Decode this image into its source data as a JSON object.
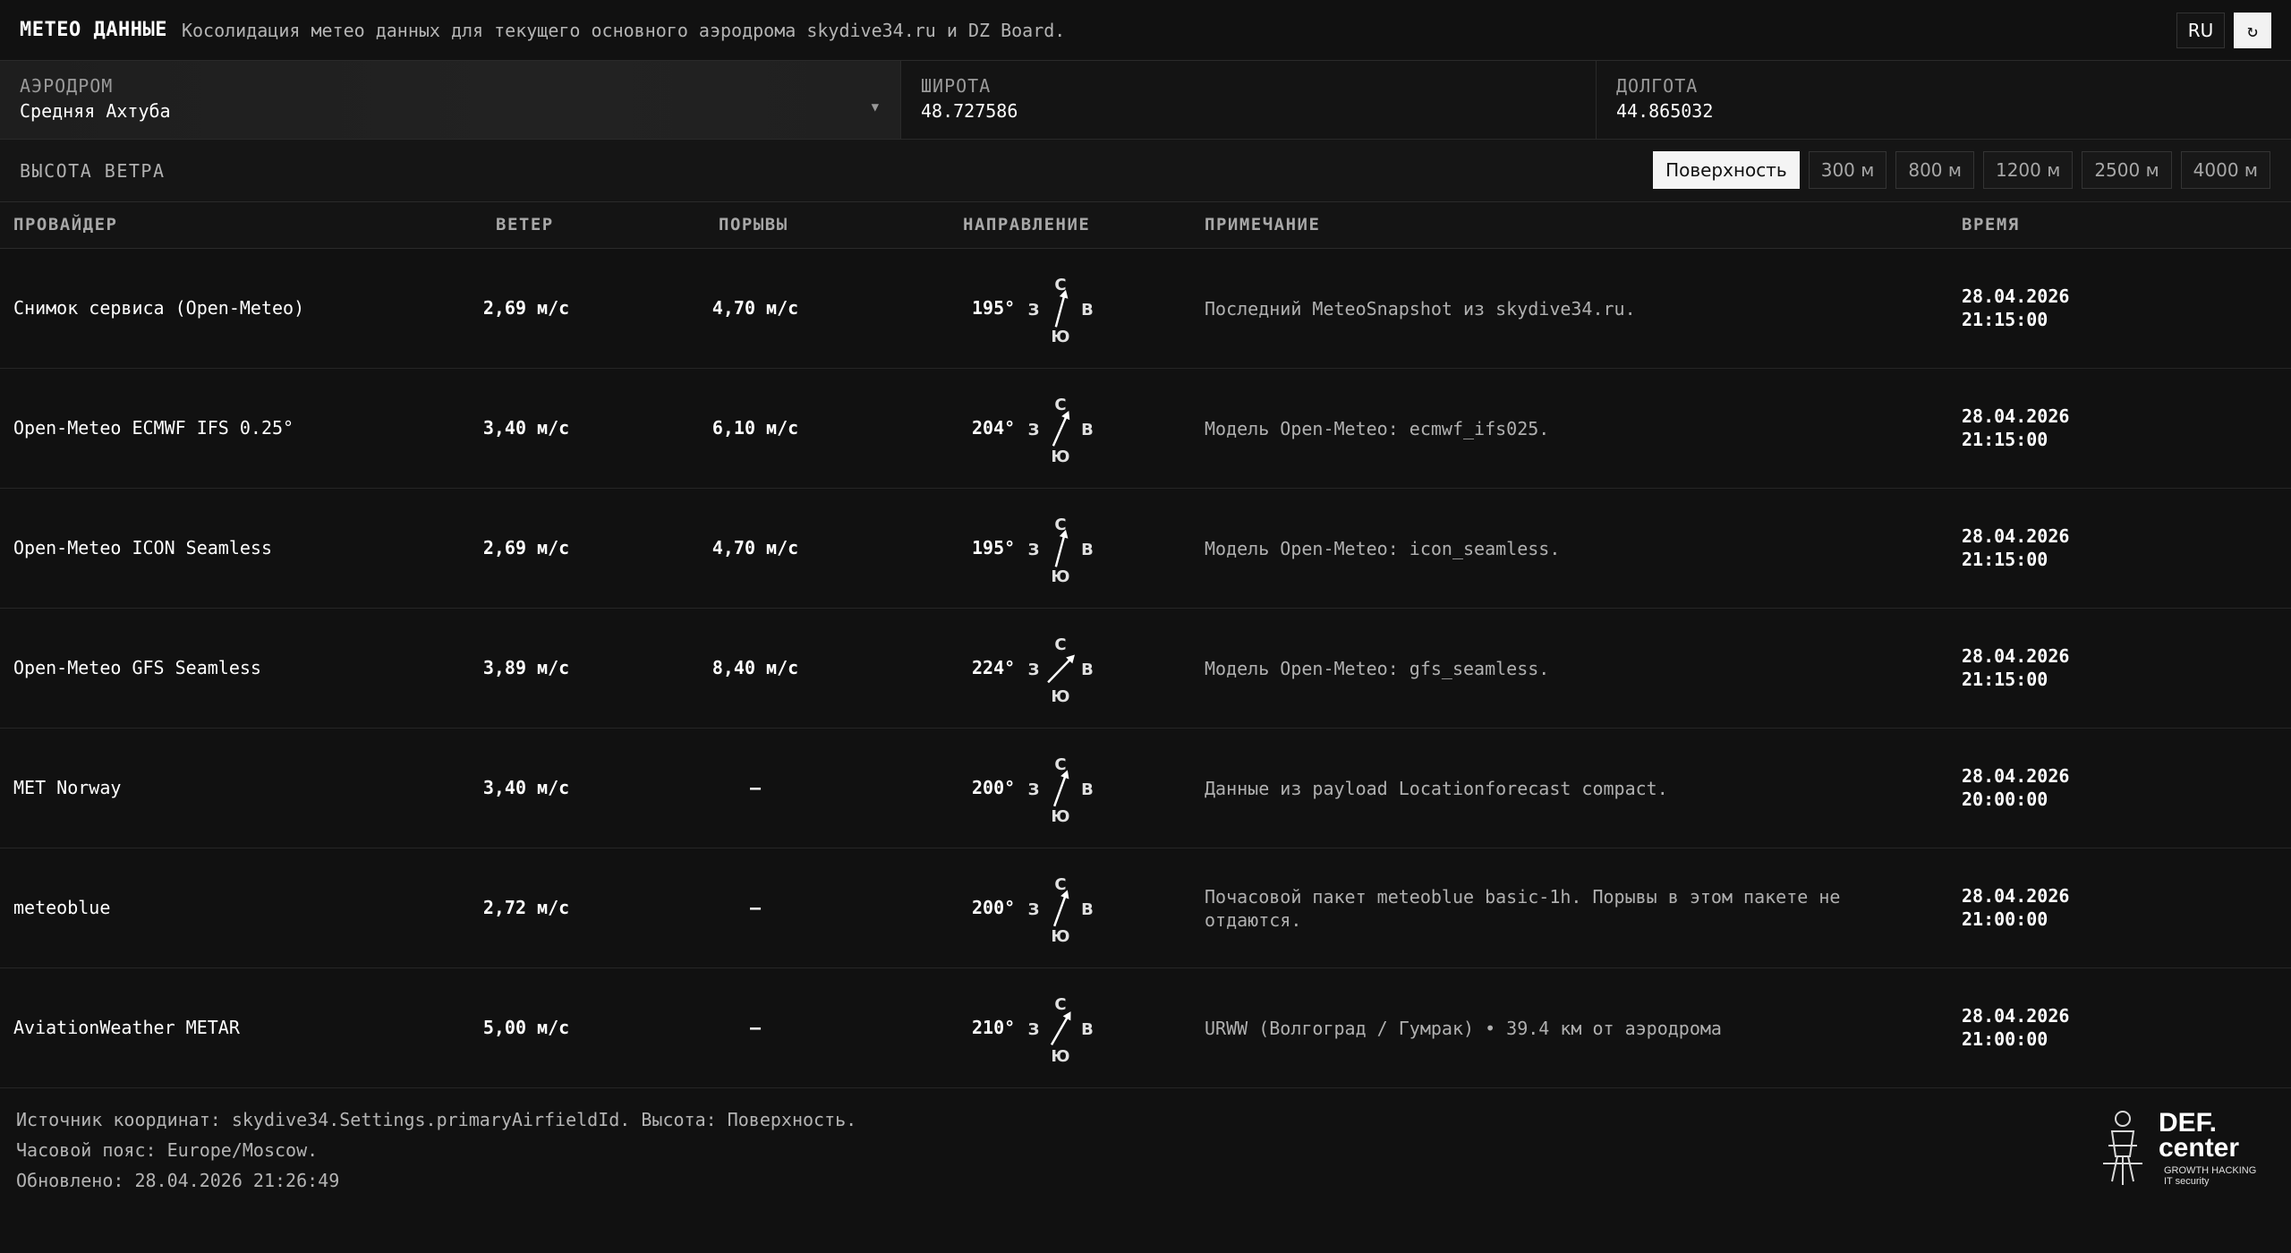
{
  "header": {
    "title": "МЕТЕО ДАННЫЕ",
    "subtitle": "Косолидация метео данных для текущего основного аэродрома skydive34.ru и DZ Board.",
    "lang": "RU",
    "refresh_glyph": "↻"
  },
  "coords": {
    "airfield_label": "АЭРОДРОМ",
    "airfield_value": "Средняя Ахтуба",
    "lat_label": "ШИРОТА",
    "lat_value": "48.727586",
    "lon_label": "ДОЛГОТА",
    "lon_value": "44.865032"
  },
  "altitude": {
    "label": "ВЫСОТА ВЕТРА",
    "options": [
      "Поверхность",
      "300 м",
      "800 м",
      "1200 м",
      "2500 м",
      "4000 м"
    ],
    "selected": "Поверхность"
  },
  "table": {
    "headers": {
      "provider": "ПРОВАЙДЕР",
      "wind": "ВЕТЕР",
      "gusts": "ПОРЫВЫ",
      "direction": "НАПРАВЛЕНИЕ",
      "note": "ПРИМЕЧАНИЕ",
      "time": "ВРЕМЯ"
    },
    "compass_labels": {
      "n": "С",
      "s": "Ю",
      "w": "З",
      "e": "В"
    },
    "rows": [
      {
        "provider": "Снимок сервиса (Open-Meteo)",
        "wind": "2,69 м/с",
        "gusts": "4,70 м/с",
        "direction": "195°",
        "deg": 195,
        "note": "Последний MeteoSnapshot из skydive34.ru.",
        "date": "28.04.2026",
        "time": "21:15:00"
      },
      {
        "provider": "Open-Meteo ECMWF IFS 0.25°",
        "wind": "3,40 м/с",
        "gusts": "6,10 м/с",
        "direction": "204°",
        "deg": 204,
        "note": "Модель Open-Meteo: ecmwf_ifs025.",
        "date": "28.04.2026",
        "time": "21:15:00"
      },
      {
        "provider": "Open-Meteo ICON Seamless",
        "wind": "2,69 м/с",
        "gusts": "4,70 м/с",
        "direction": "195°",
        "deg": 195,
        "note": "Модель Open-Meteo: icon_seamless.",
        "date": "28.04.2026",
        "time": "21:15:00"
      },
      {
        "provider": "Open-Meteo GFS Seamless",
        "wind": "3,89 м/с",
        "gusts": "8,40 м/с",
        "direction": "224°",
        "deg": 224,
        "note": "Модель Open-Meteo: gfs_seamless.",
        "date": "28.04.2026",
        "time": "21:15:00"
      },
      {
        "provider": "MET Norway",
        "wind": "3,40 м/с",
        "gusts": "—",
        "direction": "200°",
        "deg": 200,
        "note": "Данные из payload Locationforecast compact.",
        "date": "28.04.2026",
        "time": "20:00:00"
      },
      {
        "provider": "meteoblue",
        "wind": "2,72 м/с",
        "gusts": "—",
        "direction": "200°",
        "deg": 200,
        "note": "Почасовой пакет meteoblue basic-1h. Порывы в этом пакете не отдаются.",
        "date": "28.04.2026",
        "time": "21:00:00"
      },
      {
        "provider": "AviationWeather METAR",
        "wind": "5,00 м/с",
        "gusts": "—",
        "direction": "210°",
        "deg": 210,
        "note": "URWW (Волгоград / Гумрак) • 39.4 км от аэродрома",
        "date": "28.04.2026",
        "time": "21:00:00"
      }
    ]
  },
  "footer": {
    "line1": "Источник координат: skydive34.Settings.primaryAirfieldId. Высота: Поверхность.",
    "line2": "Часовой пояс: Europe/Moscow.",
    "line3": "Обновлено: 28.04.2026 21:26:49"
  },
  "logo": {
    "line1": "DEF.",
    "line2": "center",
    "tag1": "GROWTH HACKING",
    "tag2": "IT security"
  }
}
